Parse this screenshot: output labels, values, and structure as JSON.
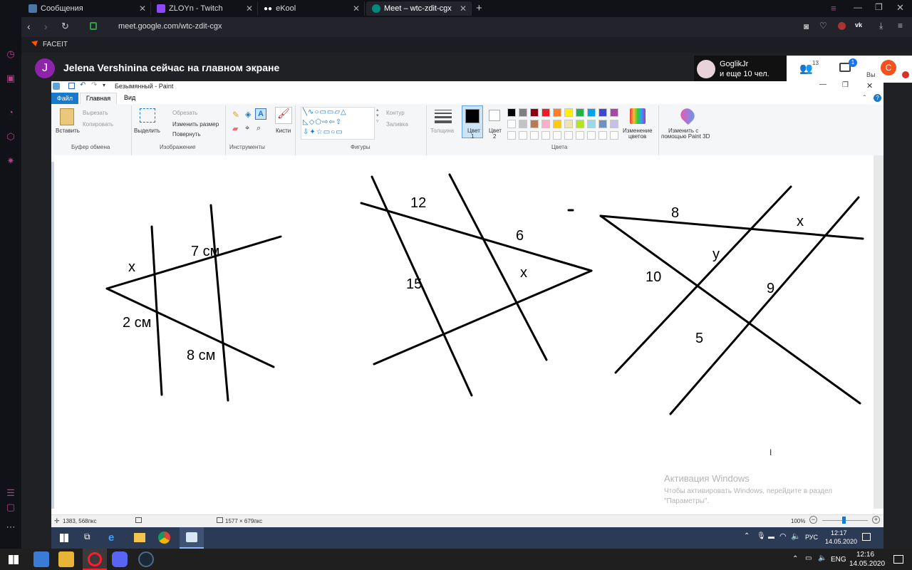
{
  "browser": {
    "tabs": [
      {
        "title": "Сообщения",
        "active": false
      },
      {
        "title": "ZLOYn - Twitch",
        "active": false
      },
      {
        "title": "eKool",
        "active": false
      },
      {
        "title": "Meet – wtc-zdit-cgx",
        "active": true
      }
    ],
    "url": "meet.google.com/wtc-zdit-cgx",
    "bookmark": "FACEIT"
  },
  "meet": {
    "presenter_initial": "J",
    "presenter_text": "Jelena Vershinina сейчас на главном экране",
    "participant_name": "GoglikJr",
    "participant_others": "и еще 10 чел.",
    "people_count": "13",
    "chat_badge": "1",
    "self_label": "Вы",
    "self_initial": "C"
  },
  "paint": {
    "title": "Безымянный - Paint",
    "tabs": {
      "file": "Файл",
      "home": "Главная",
      "view": "Вид"
    },
    "clipboard": {
      "paste": "Вставить",
      "cut": "Вырезать",
      "copy": "Копировать",
      "group": "Буфер обмена"
    },
    "image": {
      "select": "Выделить",
      "crop": "Обрезать",
      "resize": "Изменить размер",
      "rotate": "Повернуть",
      "group": "Изображение"
    },
    "tools": {
      "group": "Инструменты"
    },
    "brushes": "Кисти",
    "shapes": {
      "outline": "Контур",
      "fill": "Заливка",
      "group": "Фигуры"
    },
    "size": "Толщина",
    "color1": {
      "label": "Цвет",
      "num": "1"
    },
    "color2": {
      "label": "Цвет",
      "num": "2"
    },
    "colors_group": "Цвета",
    "edit_colors": [
      "Изменение",
      "цветов"
    ],
    "paint3d": [
      "Изменить с",
      "помощью Paint 3D"
    ],
    "palette_row1": [
      "#000000",
      "#7f7f7f",
      "#880015",
      "#ed1c24",
      "#ff7f27",
      "#fff200",
      "#22b14c",
      "#00a2e8",
      "#3f48cc",
      "#a349a4"
    ],
    "palette_row2": [
      "#ffffff",
      "#c3c3c3",
      "#b97a57",
      "#ffaec9",
      "#ffc90e",
      "#efe4b0",
      "#b5e61d",
      "#99d9ea",
      "#7092be",
      "#c8bfe7"
    ],
    "status": {
      "cursor_pos": "1383, 568пкс",
      "canvas_size": "1577 × 679пкс",
      "zoom": "100%"
    }
  },
  "drawing_labels": {
    "fig1": [
      "x",
      "7 см",
      "2 см",
      "8 см"
    ],
    "fig2": [
      "12",
      "6",
      "15",
      "x"
    ],
    "fig3": [
      "8",
      "x",
      "у",
      "10",
      "9",
      "5"
    ]
  },
  "activation": {
    "title": "Активация Windows",
    "line1": "Чтобы активировать Windows, перейдите в раздел",
    "line2": "\"Параметры\"."
  },
  "inner_taskbar": {
    "lang": "РУС",
    "time": "12:17",
    "date": "14.05.2020"
  },
  "taskbar": {
    "lang": "ENG",
    "time": "12:16",
    "date": "14.05.2020"
  }
}
